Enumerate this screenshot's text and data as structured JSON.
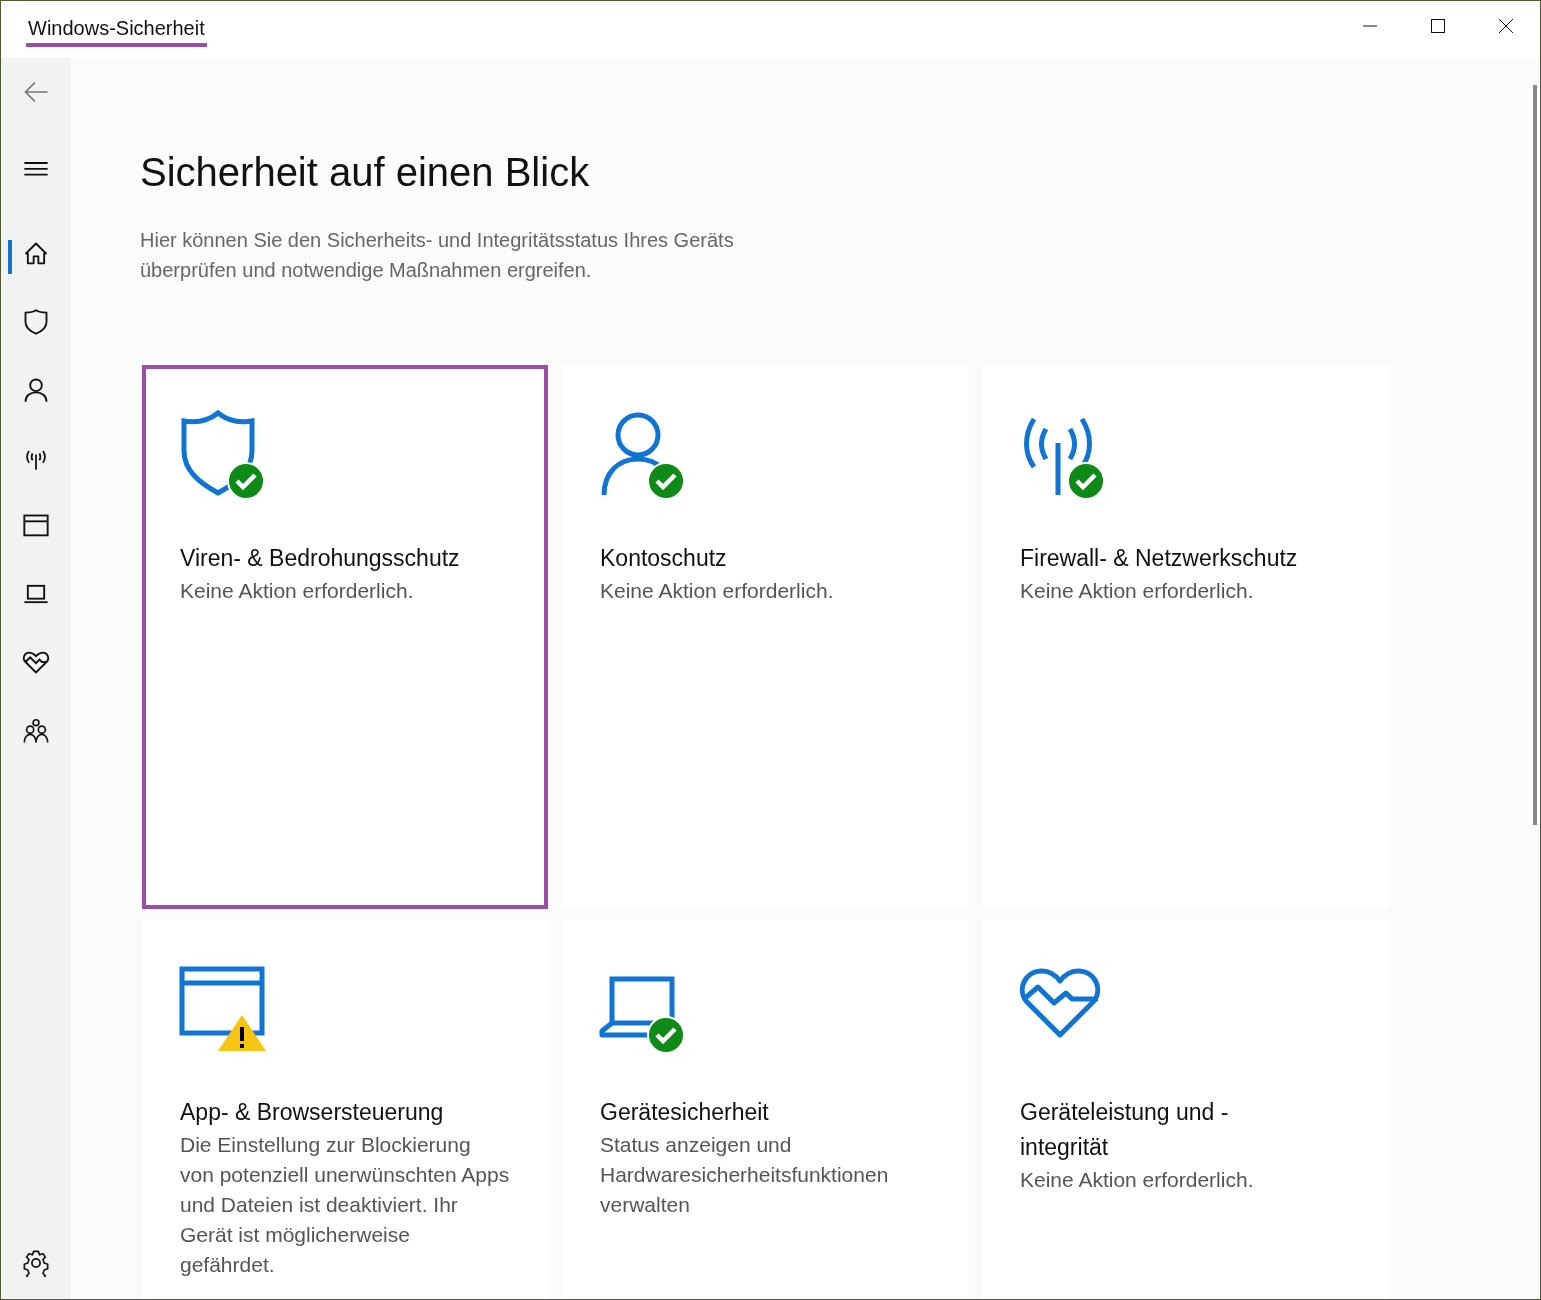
{
  "window": {
    "title": "Windows-Sicherheit",
    "title_highlighted": true
  },
  "sidebar": {
    "items": [
      {
        "kind": "back",
        "selected": false
      },
      {
        "kind": "menu",
        "selected": false
      },
      {
        "kind": "home",
        "selected": true
      },
      {
        "kind": "shield",
        "selected": false
      },
      {
        "kind": "person",
        "selected": false
      },
      {
        "kind": "antenna",
        "selected": false
      },
      {
        "kind": "browser",
        "selected": false
      },
      {
        "kind": "laptop",
        "selected": false
      },
      {
        "kind": "heart",
        "selected": false
      },
      {
        "kind": "family",
        "selected": false
      }
    ],
    "settings": {
      "kind": "gear",
      "selected": false
    }
  },
  "heading": "Sicherheit auf einen Blick",
  "description": "Hier können Sie den Sicherheits- und Integritätsstatus Ihres Geräts überprüfen und notwendige Maßnahmen ergreifen.",
  "cards": [
    {
      "kind": "shield",
      "checked": true,
      "warning": false,
      "highlighted": true,
      "title": "Viren- & Bedrohungsschutz",
      "subtitle": "Keine Aktion erforderlich."
    },
    {
      "kind": "person",
      "checked": true,
      "warning": false,
      "highlighted": false,
      "title": "Kontoschutz",
      "subtitle": "Keine Aktion erforderlich."
    },
    {
      "kind": "antenna",
      "checked": true,
      "warning": false,
      "highlighted": false,
      "title": "Firewall- & Netzwerkschutz",
      "subtitle": "Keine Aktion erforderlich."
    },
    {
      "kind": "browser",
      "checked": false,
      "warning": true,
      "highlighted": false,
      "title": "App- & Browsersteuerung",
      "subtitle": "Die Einstellung zur Blockierung von potenziell unerwünschten Apps und Dateien ist deaktiviert. Ihr Gerät ist möglicherweise gefährdet."
    },
    {
      "kind": "laptop",
      "checked": true,
      "warning": false,
      "highlighted": false,
      "title": "Gerätesicherheit",
      "subtitle": "Status anzeigen und Hardwaresicherheitsfunktionen verwalten"
    },
    {
      "kind": "heart",
      "checked": false,
      "warning": false,
      "highlighted": false,
      "title": "Geräteleistung und -integrität",
      "subtitle": "Keine Aktion erforderlich."
    }
  ]
}
